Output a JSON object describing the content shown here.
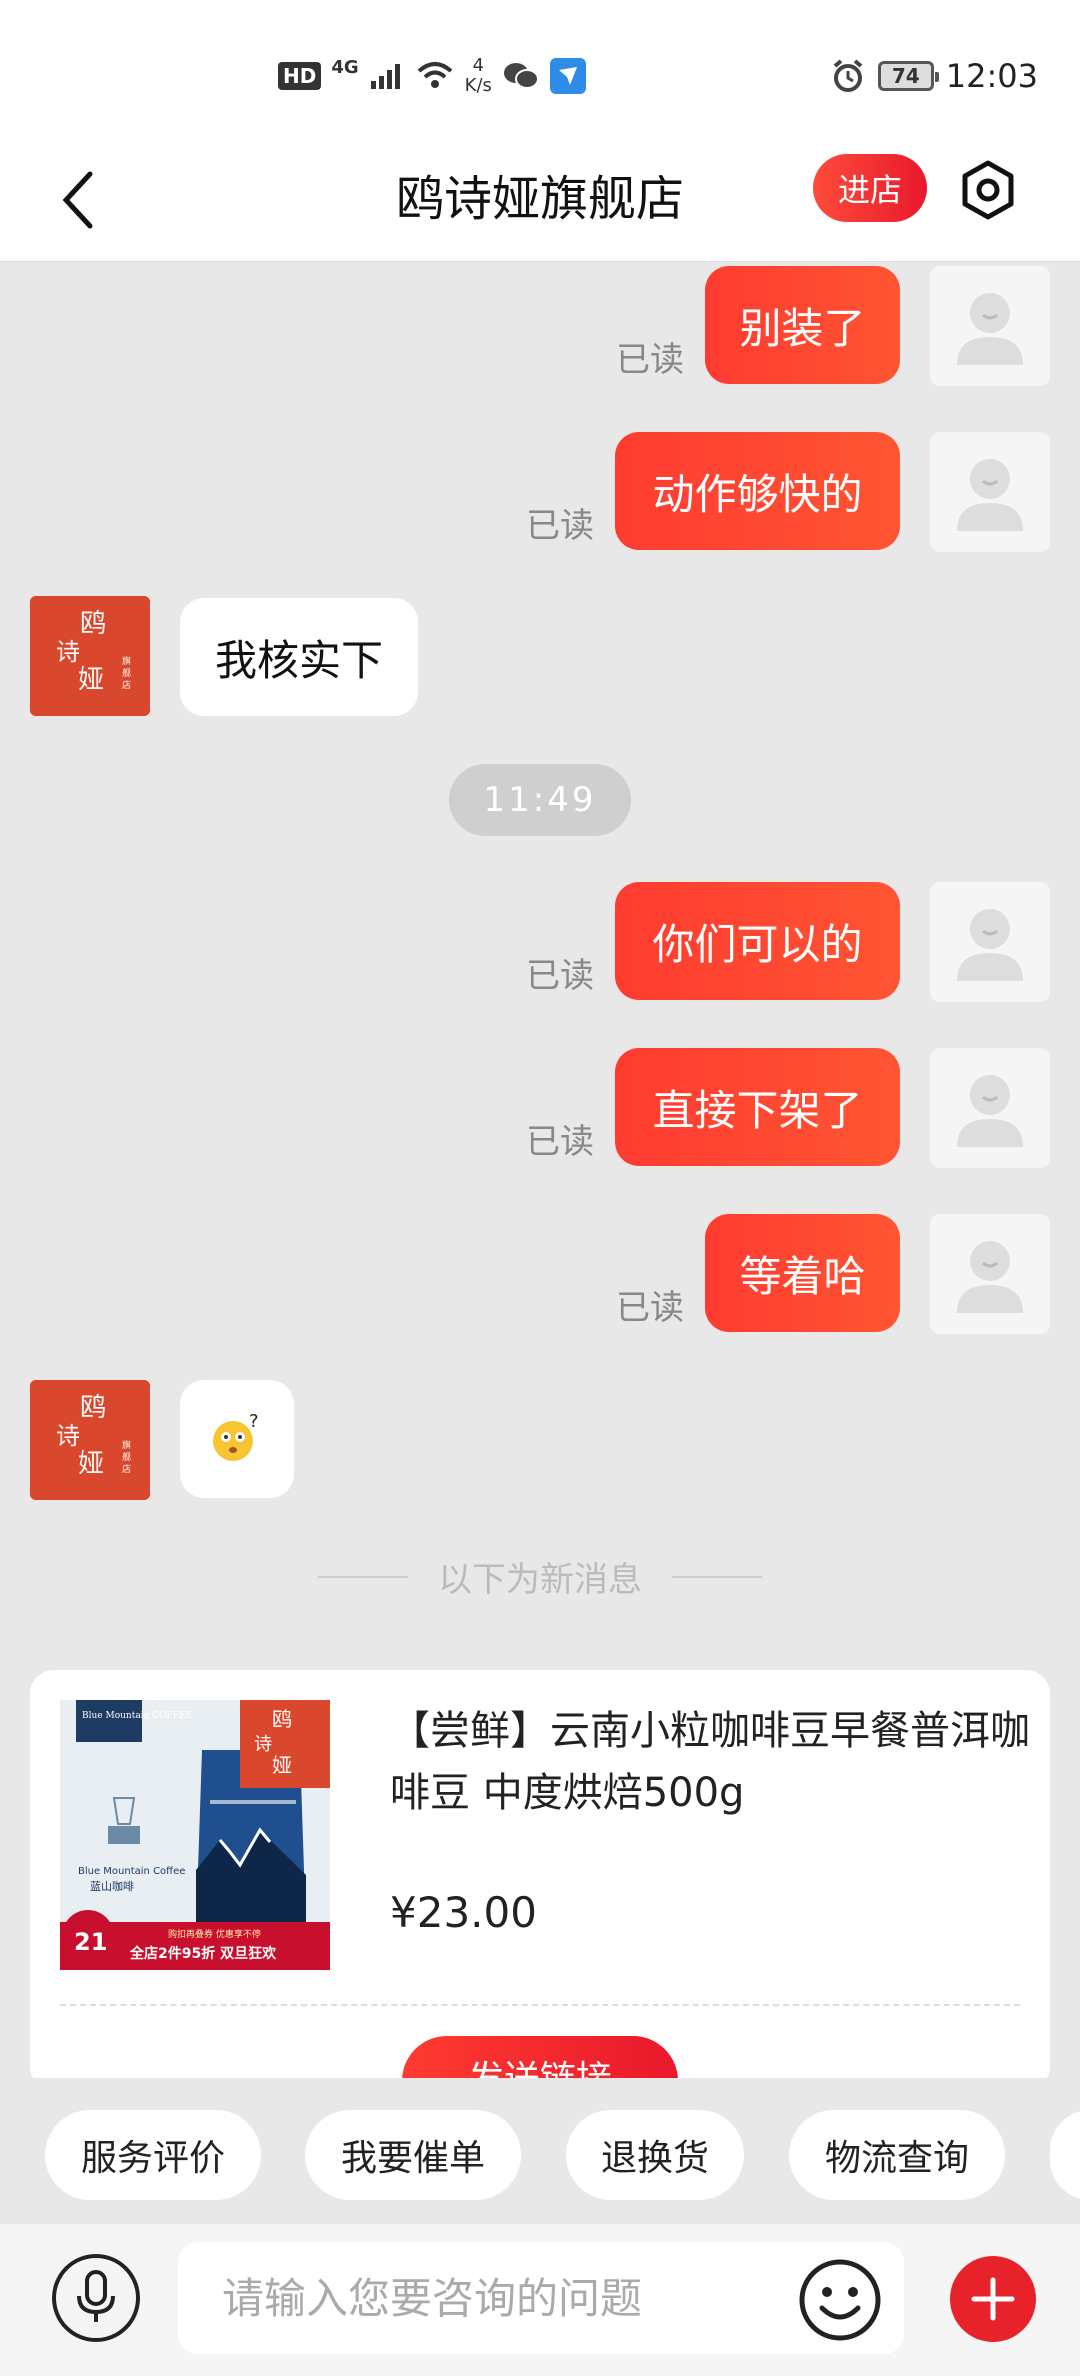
{
  "status_bar": {
    "hd": "HD",
    "network": "4G",
    "speed_value": "4",
    "speed_unit": "K/s",
    "battery": "74",
    "time": "12:03"
  },
  "header": {
    "title": "鸥诗娅旗舰店",
    "enter_store": "进店"
  },
  "messages": {
    "m1": {
      "text": "别装了",
      "status": "已读"
    },
    "m2": {
      "text": "动作够快的",
      "status": "已读"
    },
    "m3": {
      "text": "我核实下"
    },
    "time_separator": "11:49",
    "m4": {
      "text": "你们可以的",
      "status": "已读"
    },
    "m5": {
      "text": "直接下架了",
      "status": "已读"
    },
    "m6": {
      "text": "等着哈",
      "status": "已读"
    },
    "new_messages_divider": "以下为新消息"
  },
  "shop_avatar": {
    "brand_chars": [
      "鸥",
      "诗",
      "娅"
    ],
    "tag": "旗舰店"
  },
  "product_card": {
    "title": "【尝鲜】云南小粒咖啡豆早餐普洱咖啡豆  中度烘焙500g",
    "price": "¥23.00",
    "send_link_label": "发送链接",
    "image": {
      "brand_top": "Blue Mountain COFFEE",
      "label_en": "Blue Mountain Coffee",
      "label_cn": "蓝山咖啡",
      "badge_number": "21",
      "promo_line1": "购扣再叠券 优惠享不停",
      "promo_line2": "全店2件95折 双旦狂欢"
    }
  },
  "quick_replies": [
    "服务评价",
    "我要催单",
    "退换货",
    "物流查询"
  ],
  "input": {
    "placeholder": "请输入您要咨询的问题"
  },
  "colors": {
    "accent": "#ff3b30",
    "chat_bg": "#e8e8e8",
    "shop_brand": "#d9482d"
  }
}
